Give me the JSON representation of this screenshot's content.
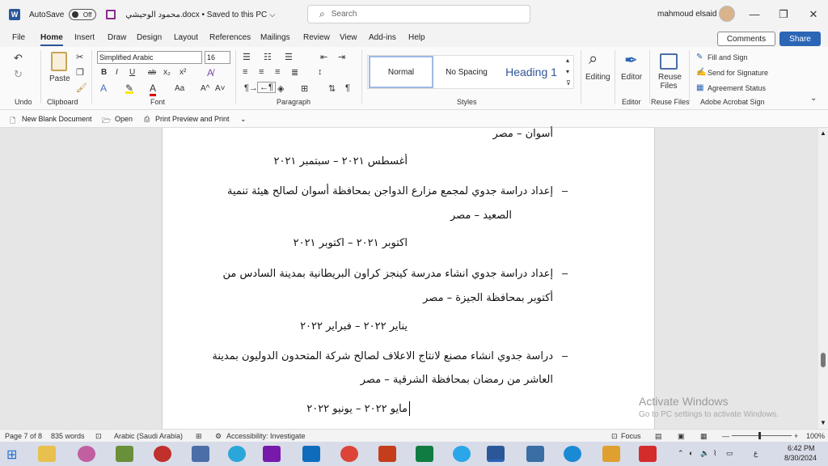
{
  "titlebar": {
    "app_logo": "W",
    "autosave_label": "AutoSave",
    "autosave_state": "Off",
    "doc_title": "محمود الوحيشي.docx • Saved to this PC ⌵",
    "search_placeholder": "Search",
    "user_name": "mahmoud elsaid",
    "minimize": "—",
    "restore": "❐",
    "close": "✕"
  },
  "menu": {
    "tabs": [
      "File",
      "Home",
      "Insert",
      "Draw",
      "Design",
      "Layout",
      "References",
      "Mailings",
      "Review",
      "View",
      "Add-ins",
      "Help"
    ],
    "comments": "Comments",
    "share": "Share"
  },
  "ribbon": {
    "undo_label": "Undo",
    "clipboard_label": "Clipboard",
    "paste": "Paste",
    "font_label": "Font",
    "font_name": "Simplified Arabic",
    "font_size": "16",
    "paragraph_label": "Paragraph",
    "styles_label": "Styles",
    "styles": [
      "Normal",
      "No Spacing",
      "Heading 1"
    ],
    "editing": "Editing",
    "editor": "Editor",
    "editor_label": "Editor",
    "reuse_files": "Reuse Files",
    "reuse_label": "Reuse Files",
    "acrobat": [
      "Fill and Sign",
      "Send for Signature",
      "Agreement Status"
    ],
    "acrobat_label": "Adobe Acrobat Sign",
    "font_buttons": [
      "B",
      "I",
      "U",
      "ab",
      "x₂",
      "x²",
      "A",
      "Aa",
      "A^",
      "A˅"
    ]
  },
  "quick_access": {
    "new_blank": "New Blank Document",
    "open": "Open",
    "print_preview": "Print Preview and Print"
  },
  "document": {
    "lines": [
      "أسوان – مصر",
      "أغسطس ٢٠٢١ – سبتمبر ٢٠٢١",
      "إعداد دراسة جدوي لمجمع مزارع الدواجن بمحافظة أسوان لصالح هيئة تنمية",
      "الصعيد – مصر",
      "اكتوبر ٢٠٢١ – اكتوبر ٢٠٢١",
      "إعداد دراسة جدوي انشاء مدرسة كينجز كراون البريطانية بمدينة السادس من",
      "أكتوبر بمحافظة الجيزة – مصر",
      "يناير ٢٠٢٢ – فبراير ٢٠٢٢",
      "دراسة جدوي انشاء مصنع لانتاج الاعلاف لصالح شركة المتحدون الدوليون بمدينة",
      "العاشر من رمضان بمحافظة الشرقية – مصر",
      "مايو ٢٠٢٢ – يونيو ٢٠٢٢"
    ],
    "bullet": "–"
  },
  "watermark": {
    "line1": "Activate Windows",
    "line2": "Go to PC settings to activate Windows."
  },
  "statusbar": {
    "page": "Page 7 of 8",
    "words": "835 words",
    "language": "Arabic (Saudi Arabia)",
    "accessibility": "Accessibility: Investigate",
    "focus": "Focus",
    "zoom": "100%"
  },
  "taskbar": {
    "time": "6:42 PM",
    "date": "8/30/2024",
    "lang": "ع"
  }
}
